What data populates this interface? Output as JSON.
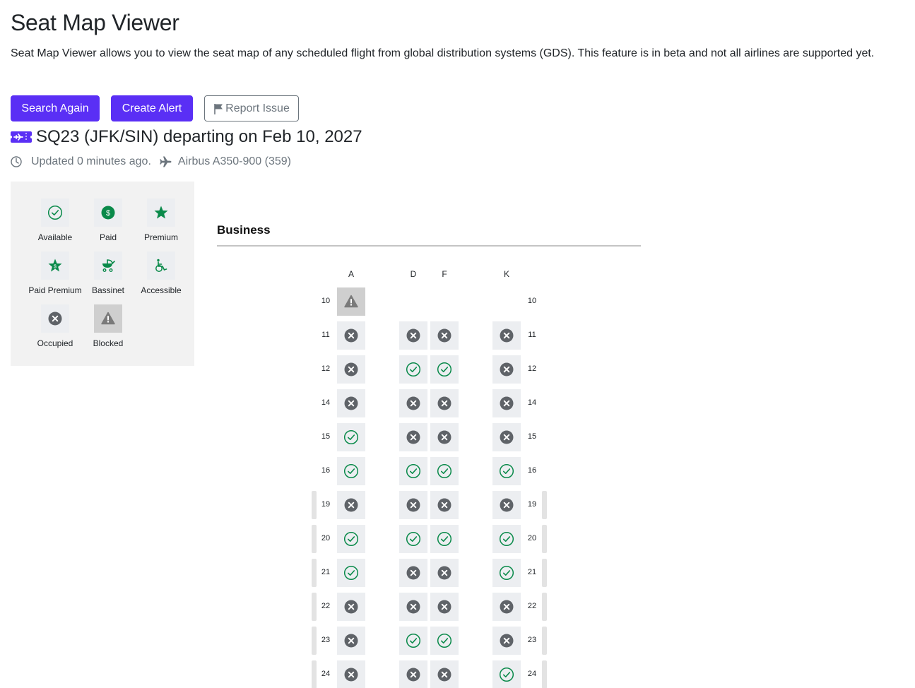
{
  "page": {
    "title": "Seat Map Viewer",
    "intro": "Seat Map Viewer allows you to view the seat map of any scheduled flight from global distribution systems (GDS). This feature is in beta and not all airlines are supported yet."
  },
  "buttons": {
    "search_again": "Search Again",
    "create_alert": "Create Alert",
    "report_issue": "Report Issue"
  },
  "flight": {
    "title": "SQ23 (JFK/SIN) departing on Feb 10, 2027",
    "updated": "Updated 0 minutes ago.",
    "aircraft": "Airbus A350-900 (359)"
  },
  "legend": [
    {
      "label": "Available",
      "icon": "available-icon"
    },
    {
      "label": "Paid",
      "icon": "paid-icon"
    },
    {
      "label": "Premium",
      "icon": "premium-icon"
    },
    {
      "label": "Paid Premium",
      "icon": "paid-premium-icon"
    },
    {
      "label": "Bassinet",
      "icon": "bassinet-icon"
    },
    {
      "label": "Accessible",
      "icon": "accessible-icon"
    },
    {
      "label": "Occupied",
      "icon": "occupied-icon"
    },
    {
      "label": "Blocked",
      "icon": "blocked-icon"
    }
  ],
  "colors": {
    "primary": "#5a2ff5",
    "available": "#0a8a4a",
    "occupied": "#5f6368",
    "blocked": "#7a7a7a"
  },
  "cabin": {
    "name": "Business",
    "columns": [
      "A",
      "D",
      "F",
      "K"
    ],
    "rows": [
      {
        "row": "10",
        "exit": false,
        "seats": [
          "blocked",
          null,
          null,
          null
        ]
      },
      {
        "row": "11",
        "exit": false,
        "seats": [
          "occupied",
          "occupied",
          "occupied",
          "occupied"
        ]
      },
      {
        "row": "12",
        "exit": false,
        "seats": [
          "occupied",
          "available",
          "available",
          "occupied"
        ]
      },
      {
        "row": "14",
        "exit": false,
        "seats": [
          "occupied",
          "occupied",
          "occupied",
          "occupied"
        ]
      },
      {
        "row": "15",
        "exit": false,
        "seats": [
          "available",
          "occupied",
          "occupied",
          "occupied"
        ]
      },
      {
        "row": "16",
        "exit": false,
        "seats": [
          "available",
          "available",
          "available",
          "available"
        ]
      },
      {
        "row": "19",
        "exit": true,
        "seats": [
          "occupied",
          "occupied",
          "occupied",
          "occupied"
        ]
      },
      {
        "row": "20",
        "exit": true,
        "seats": [
          "available",
          "available",
          "available",
          "available"
        ]
      },
      {
        "row": "21",
        "exit": true,
        "seats": [
          "available",
          "occupied",
          "occupied",
          "available"
        ]
      },
      {
        "row": "22",
        "exit": true,
        "seats": [
          "occupied",
          "occupied",
          "occupied",
          "occupied"
        ]
      },
      {
        "row": "23",
        "exit": true,
        "seats": [
          "occupied",
          "available",
          "available",
          "occupied"
        ]
      },
      {
        "row": "24",
        "exit": true,
        "seats": [
          "occupied",
          "occupied",
          "occupied",
          "available"
        ]
      }
    ]
  }
}
